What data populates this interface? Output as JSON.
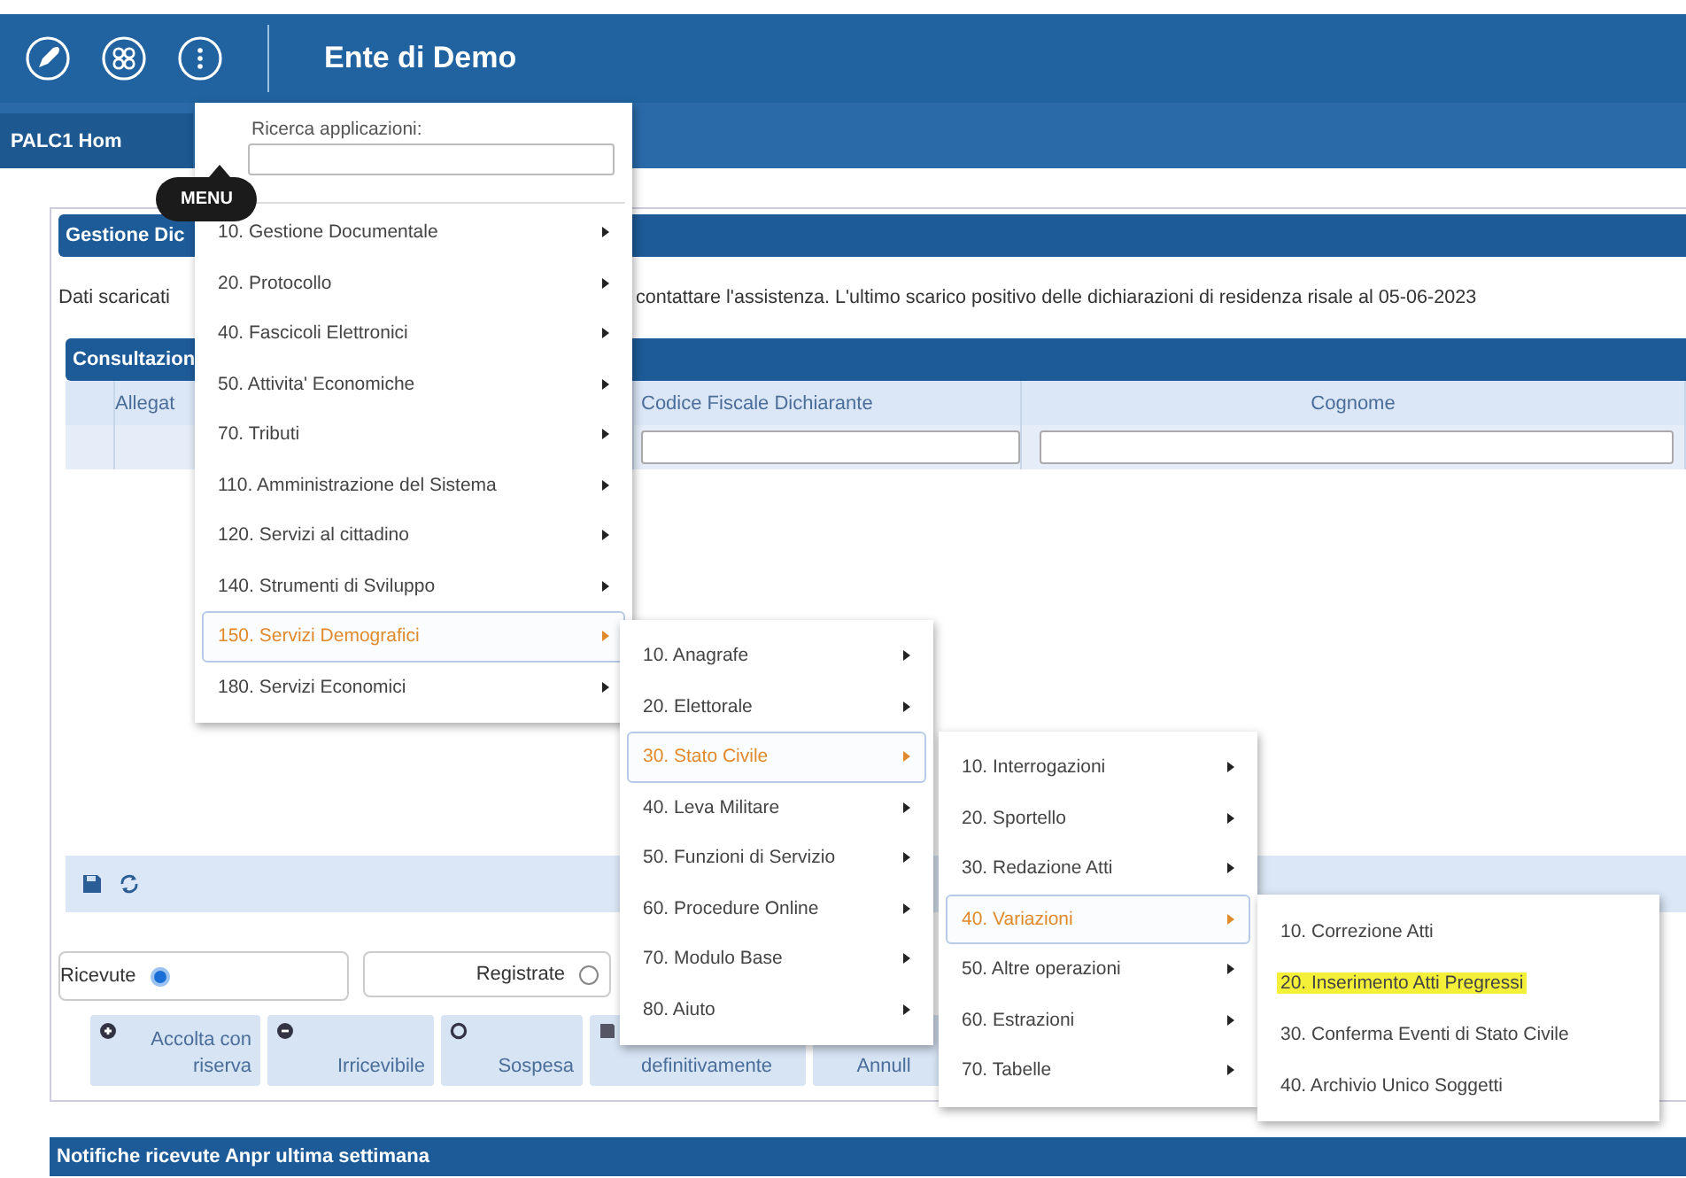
{
  "header": {
    "title": "Ente di Demo"
  },
  "tabs": [
    {
      "label": "PALC1 Hom",
      "selected": true
    }
  ],
  "tooltip": {
    "text": "MENU"
  },
  "panel": {
    "title": "Gestione Dic",
    "notice_left": "Dati scaricati",
    "notice_right": "contattare l'assistenza. L'ultimo scarico positivo delle dichiarazioni di residenza risale al 05-06-2023"
  },
  "grid": {
    "title": "Consultazion",
    "columns": [
      "Allegat",
      "Codice Fiscale Dichiarante",
      "Cognome"
    ]
  },
  "radios": [
    {
      "label": "Ricevute",
      "selected": true
    },
    {
      "label": "Registrate",
      "selected": false
    }
  ],
  "actions": [
    {
      "kind": "plus",
      "label": "Accolta con riserva"
    },
    {
      "kind": "minus",
      "label": "Irricevibile"
    },
    {
      "kind": "ring",
      "label": "Sospesa"
    },
    {
      "kind": "save",
      "label": "definitivamente"
    },
    {
      "kind": "none",
      "label": "Annull"
    }
  ],
  "notifications": {
    "title": "Notifiche ricevute Anpr ultima settimana"
  },
  "menus": [
    {
      "search_label": "Ricerca applicazioni:",
      "items": [
        {
          "label": "10. Gestione Documentale",
          "submenu": true,
          "selected": false,
          "highlighted": false
        },
        {
          "label": "20. Protocollo",
          "submenu": true,
          "selected": false,
          "highlighted": false
        },
        {
          "label": "40. Fascicoli Elettronici",
          "submenu": true,
          "selected": false,
          "highlighted": false
        },
        {
          "label": "50. Attivita' Economiche",
          "submenu": true,
          "selected": false,
          "highlighted": false
        },
        {
          "label": "70. Tributi",
          "submenu": true,
          "selected": false,
          "highlighted": false
        },
        {
          "label": "110. Amministrazione del Sistema",
          "submenu": true,
          "selected": false,
          "highlighted": false
        },
        {
          "label": "120. Servizi al cittadino",
          "submenu": true,
          "selected": false,
          "highlighted": false
        },
        {
          "label": "140. Strumenti di Sviluppo",
          "submenu": true,
          "selected": false,
          "highlighted": false
        },
        {
          "label": "150. Servizi Demografici",
          "submenu": true,
          "selected": true,
          "highlighted": false
        },
        {
          "label": "180. Servizi Economici",
          "submenu": true,
          "selected": false,
          "highlighted": false
        }
      ]
    },
    {
      "items": [
        {
          "label": "10. Anagrafe",
          "submenu": true,
          "selected": false,
          "highlighted": false
        },
        {
          "label": "20. Elettorale",
          "submenu": true,
          "selected": false,
          "highlighted": false
        },
        {
          "label": "30. Stato Civile",
          "submenu": true,
          "selected": true,
          "highlighted": false
        },
        {
          "label": "40. Leva Militare",
          "submenu": true,
          "selected": false,
          "highlighted": false
        },
        {
          "label": "50. Funzioni di Servizio",
          "submenu": true,
          "selected": false,
          "highlighted": false
        },
        {
          "label": "60. Procedure Online",
          "submenu": true,
          "selected": false,
          "highlighted": false
        },
        {
          "label": "70. Modulo Base",
          "submenu": true,
          "selected": false,
          "highlighted": false
        },
        {
          "label": "80. Aiuto",
          "submenu": true,
          "selected": false,
          "highlighted": false
        }
      ]
    },
    {
      "items": [
        {
          "label": "10. Interrogazioni",
          "submenu": true,
          "selected": false,
          "highlighted": false
        },
        {
          "label": "20. Sportello",
          "submenu": true,
          "selected": false,
          "highlighted": false
        },
        {
          "label": "30. Redazione Atti",
          "submenu": true,
          "selected": false,
          "highlighted": false
        },
        {
          "label": "40. Variazioni",
          "submenu": true,
          "selected": true,
          "highlighted": false
        },
        {
          "label": "50. Altre operazioni",
          "submenu": true,
          "selected": false,
          "highlighted": false
        },
        {
          "label": "60. Estrazioni",
          "submenu": true,
          "selected": false,
          "highlighted": false
        },
        {
          "label": "70. Tabelle",
          "submenu": true,
          "selected": false,
          "highlighted": false
        }
      ]
    },
    {
      "items": [
        {
          "label": "10. Correzione Atti",
          "submenu": false,
          "selected": false,
          "highlighted": false
        },
        {
          "label": "20. Inserimento Atti Pregressi",
          "submenu": false,
          "selected": false,
          "highlighted": true
        },
        {
          "label": "30. Conferma Eventi di Stato Civile",
          "submenu": false,
          "selected": false,
          "highlighted": false
        },
        {
          "label": "40. Archivio Unico Soggetti",
          "submenu": false,
          "selected": false,
          "highlighted": false
        }
      ]
    }
  ]
}
